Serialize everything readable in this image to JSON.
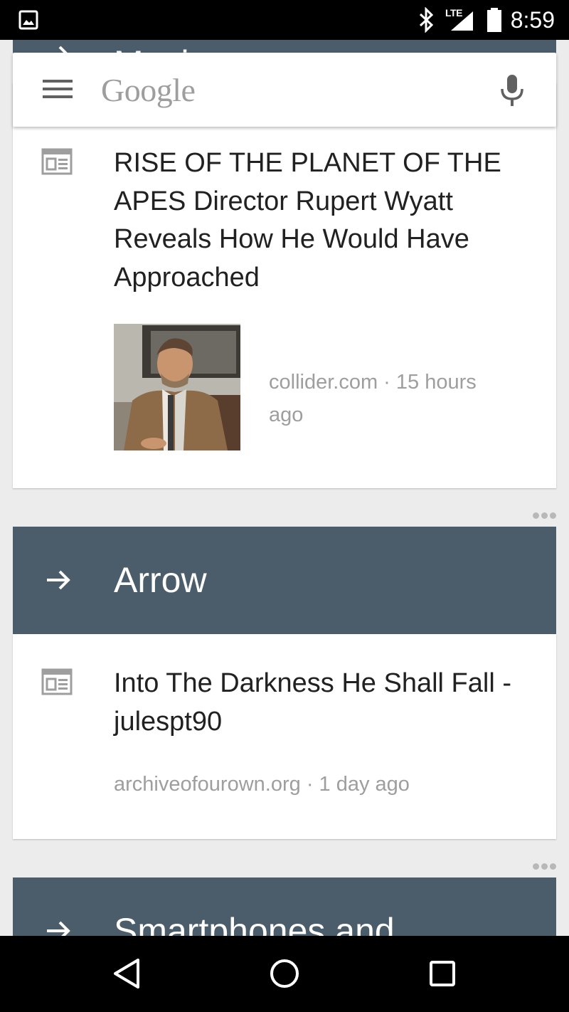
{
  "status_bar": {
    "time": "8:59",
    "network": "LTE",
    "icons": [
      "gallery-icon",
      "bluetooth-icon",
      "signal-icon",
      "battery-icon"
    ]
  },
  "search": {
    "logo_text": "Google",
    "icons": [
      "menu-icon",
      "mic-icon"
    ]
  },
  "feed": {
    "partial_topic_top": {
      "title": "Movies",
      "icon": "arrow-right-icon"
    },
    "card1": {
      "icon": "news-icon",
      "headline": "RISE OF THE PLANET OF THE APES Director Rupert Wyatt Reveals How He Would Have Approached",
      "source": "collider.com · 15 hours ago",
      "image": "man-portrait-photo"
    },
    "topic2": {
      "title": "Arrow",
      "icon": "arrow-right-icon"
    },
    "card2": {
      "icon": "news-icon",
      "headline": "Into The Darkness He Shall Fall - julespt90",
      "source": "archiveofourown.org · 1 day ago"
    },
    "topic3": {
      "title": "Smartphones and",
      "icon": "arrow-right-icon"
    }
  },
  "nav_bar": {
    "icons": [
      "back-icon",
      "home-icon",
      "recents-icon"
    ]
  },
  "colors": {
    "topic_header": "#4b5d6a",
    "background": "#ececec",
    "meta_text": "#9e9e9e",
    "card": "#ffffff"
  }
}
